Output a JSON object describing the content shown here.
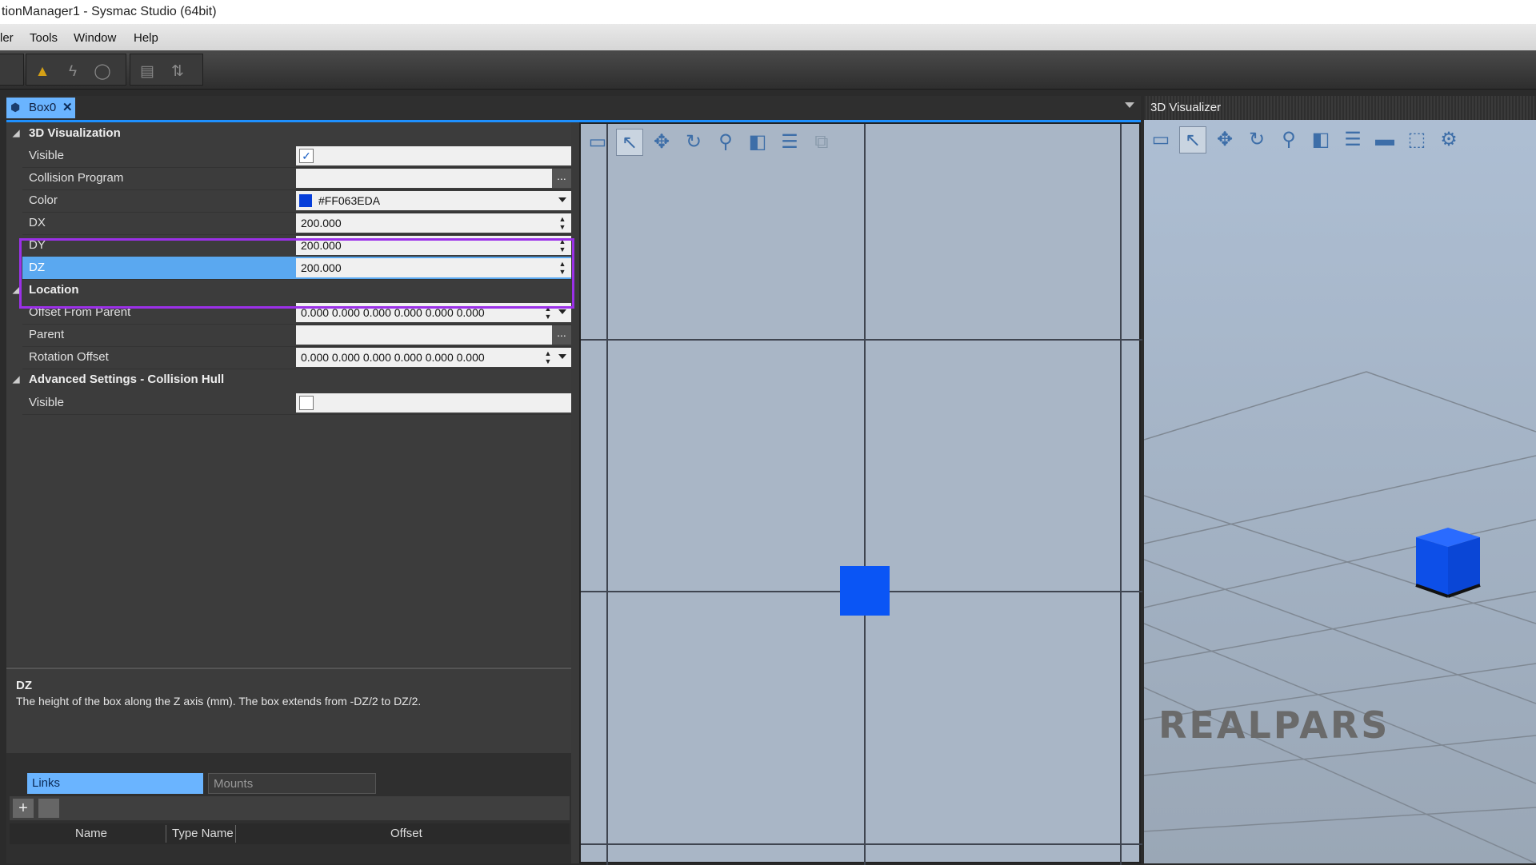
{
  "window": {
    "title": "tionManager1 - Sysmac Studio (64bit)"
  },
  "menu": {
    "items": [
      "ler",
      "Tools",
      "Window",
      "Help"
    ]
  },
  "toolbar": {
    "icons": [
      "warning-icon",
      "lightning-icon",
      "refresh-icon",
      "grid-icon",
      "transfer-icon"
    ]
  },
  "tab": {
    "label": "Box0"
  },
  "properties": {
    "cat1": "3D Visualization",
    "visible_label": "Visible",
    "collision_label": "Collision Program",
    "collision_value": "",
    "color_label": "Color",
    "color_value": "#FF063EDA",
    "color_hex": "#063EDA",
    "dx_label": "DX",
    "dx_value": "200.000",
    "dy_label": "DY",
    "dy_value": "200.000",
    "dz_label": "DZ",
    "dz_value": "200.000",
    "cat2": "Location",
    "offset_label": "Offset From Parent",
    "offset_value": "0.000 0.000 0.000 0.000 0.000 0.000",
    "parent_label": "Parent",
    "parent_value": "",
    "rotation_label": "Rotation Offset",
    "rotation_value": "0.000 0.000 0.000 0.000 0.000 0.000",
    "cat3": "Advanced Settings - Collision Hull",
    "hull_visible_label": "Visible",
    "ellipsis": "...",
    "checkmark": "✓"
  },
  "description": {
    "title": "DZ",
    "body": "The height of the box along the Z axis (mm). The box extends from -DZ/2 to DZ/2."
  },
  "links_panel": {
    "tab_links": "Links",
    "tab_mounts": "Mounts",
    "add": "+",
    "columns": [
      "Name",
      "Type Name",
      "Offset"
    ]
  },
  "visualizer": {
    "title": "3D Visualizer",
    "brand": "REALPARS"
  }
}
